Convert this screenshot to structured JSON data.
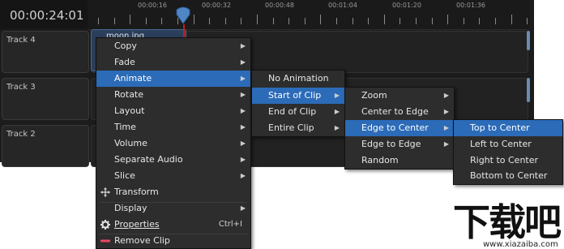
{
  "timeline": {
    "timecode": "00:00:24:01",
    "ruler_labels": [
      "00:00:16",
      "00:00:32",
      "00:00:48",
      "00:01:04",
      "00:01:20",
      "00:01:36"
    ],
    "tracks": [
      {
        "label": "Track 4"
      },
      {
        "label": "Track 3"
      },
      {
        "label": "Track 2"
      }
    ],
    "clip_name": "moon.jpg"
  },
  "context_menu": {
    "items": [
      "Copy",
      "Fade",
      "Animate",
      "Rotate",
      "Layout",
      "Time",
      "Volume",
      "Separate Audio",
      "Slice",
      "Transform",
      "Display",
      "Properties",
      "Remove Clip"
    ],
    "properties_shortcut": "Ctrl+I",
    "highlighted": "Animate"
  },
  "animate_submenu": {
    "items": [
      "No Animation",
      "Start of Clip",
      "End of Clip",
      "Entire Clip"
    ],
    "highlighted": "Start of Clip"
  },
  "start_submenu": {
    "items": [
      "Zoom",
      "Center to Edge",
      "Edge to Center",
      "Edge to Edge",
      "Random"
    ],
    "highlighted": "Edge to Center"
  },
  "edge_submenu": {
    "items": [
      "Top to Center",
      "Left to Center",
      "Right to Center",
      "Bottom to Center"
    ],
    "highlighted": "Top to Center"
  },
  "watermark": {
    "logo_text": "下载吧",
    "url": "www.xiazaiba.com"
  },
  "colors": {
    "highlight": "#2b6bb8",
    "menu_bg": "#2d2d2d",
    "playhead": "#c81a1a",
    "remove_icon": "#e84a5f"
  }
}
